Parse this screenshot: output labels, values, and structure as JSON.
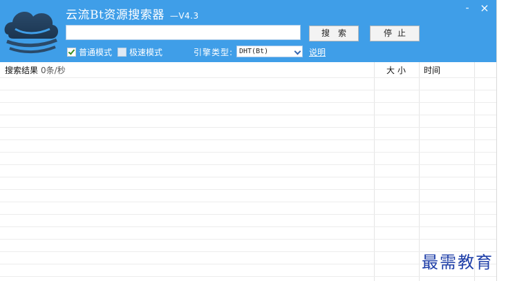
{
  "window": {
    "title": "云流Bt资源搜索器",
    "version": "—V4.3",
    "minimize_glyph": "-",
    "close_glyph": "×"
  },
  "search": {
    "value": "",
    "search_button": "搜索",
    "stop_button": "停止"
  },
  "options": {
    "normal_mode": {
      "label": "普通模式",
      "checked": true
    },
    "fast_mode": {
      "label": "极速模式",
      "checked": false
    },
    "engine_label": "引擎类型:",
    "engine_selected": "DHT(Bt)",
    "help_link": "说明"
  },
  "results": {
    "columns": [
      {
        "label": "搜索结果",
        "extra": "0条/秒"
      },
      {
        "label": "大小"
      },
      {
        "label": "时间"
      }
    ]
  },
  "watermark": "最需教育",
  "colors": {
    "header_bg": "#3f9ee8",
    "watermark": "#1f3fa8"
  },
  "icons": {
    "logo": "cloud-logo-icon",
    "engine_dropdown": "chevron-down-icon"
  }
}
